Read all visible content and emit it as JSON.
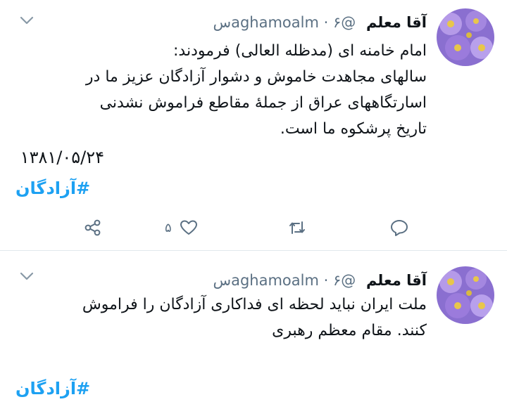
{
  "tweets": [
    {
      "author": {
        "name": "آقا معلم",
        "handle": "@aghamoalm",
        "separator": "·",
        "time": "۶س"
      },
      "body_lines": [
        "امام خامنه ای (مدظله العالی) فرمودند:",
        "سالهای مجاهدت خاموش و دشوار آزادگان عزیز ما در",
        "اسارتگاههای عراق از جملهٔ مقاطع فراموش نشدنی",
        "تاریخ پرشکوه ما است."
      ],
      "date": "۱۳۸۱/۰۵/۲۴",
      "hashtag": "#آزادگان",
      "actions": {
        "like_count": "۵"
      }
    },
    {
      "author": {
        "name": "آقا معلم",
        "handle": "@aghamoalm",
        "separator": "·",
        "time": "۶س"
      },
      "body_lines": [
        "ملت ایران نباید لحظه ای فداکاری آزادگان را فراموش",
        "کنند. مقام معظم رهبری"
      ],
      "hashtag": "#آزادگان"
    }
  ],
  "icons": {
    "reply": "reply-icon",
    "retweet": "retweet-icon",
    "like": "heart-icon",
    "share": "share-icon",
    "more": "chevron-down-icon"
  },
  "colors": {
    "accent": "#1da1f2",
    "muted": "#5b7083",
    "text": "#0f1419",
    "divider": "#e1e8ed"
  }
}
